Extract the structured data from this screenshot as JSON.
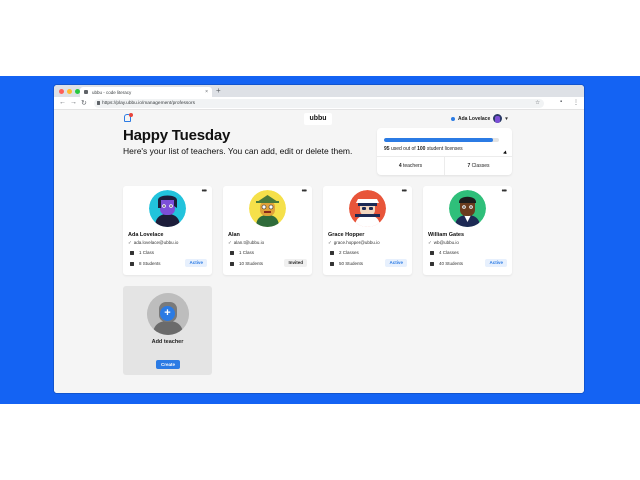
{
  "browser": {
    "tab_title": "ubbu - code literacy",
    "url": "https://play.ubbu.io/management/professors",
    "nav": {
      "back": "←",
      "forward": "→",
      "reload": "↻",
      "new_tab": "+"
    },
    "traffic_lights": [
      "#ff5f57",
      "#febc2e",
      "#28c840"
    ]
  },
  "header": {
    "logo": "ubbu",
    "user_name": "Ada Lovelace",
    "chevron": "▾"
  },
  "greeting": "Happy Tuesday",
  "subtitle": "Here's your list of teachers. You can add, edit or delete them.",
  "licenses": {
    "used": "95",
    "total": "100",
    "used_fraction": 0.95,
    "used_label": " used out of ",
    "suffix": " student licenses",
    "teachers_count": "4",
    "teachers_label": " teachers",
    "classes_count": "7",
    "classes_label": " Classes"
  },
  "teachers": [
    {
      "name": "Ada Lovelace",
      "email": "ada.lovelace@ubbu.io",
      "classes": "1 Class",
      "students": "8 Students",
      "status": "Active"
    },
    {
      "name": "Alan",
      "email": "alan.t@ubbu.io",
      "classes": "1 Class",
      "students": "10 Students",
      "status": "Invited"
    },
    {
      "name": "Grace Hopper",
      "email": "grace.hopper@ubbu.io",
      "classes": "2 Classes",
      "students": "50 Students",
      "status": "Active"
    },
    {
      "name": "William Gates",
      "email": "wb@ubbu.io",
      "classes": "4 Classes",
      "students": "40 Students",
      "status": "Active"
    }
  ],
  "add_teacher": {
    "label": "Add teacher",
    "button": "Create"
  },
  "colors": {
    "accent": "#2b7be4",
    "background_band": "#1463f3"
  }
}
